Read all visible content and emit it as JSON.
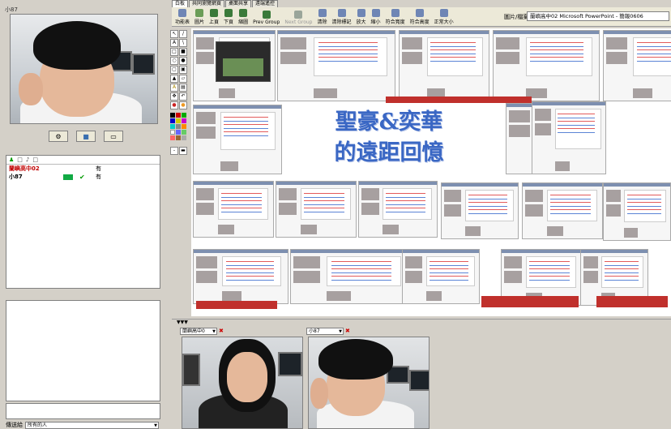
{
  "left_panel": {
    "cam_user": "小87",
    "cam_buttons": [
      "settings-icon",
      "video-icon",
      "monitor-icon"
    ],
    "user_list": {
      "header_icons": [
        "user-icon",
        "check-icon",
        "mic-icon",
        "video-icon"
      ],
      "rows": [
        {
          "name": "蘭嶼高中02",
          "status_ok": "",
          "flag": "有",
          "color": "#c00000"
        },
        {
          "name": "小87",
          "status_ok": "✔",
          "flag": "有",
          "color": "#000000"
        }
      ]
    },
    "send_label": "傳送給",
    "recipient": "所有的人"
  },
  "tabs": [
    "白板",
    "共同瀏覽網頁",
    "桌面共享",
    "遠端遙控"
  ],
  "toolbar": {
    "buttons": [
      {
        "label": "功能表",
        "icon": "menu-icon",
        "color": "#6f86b5",
        "disabled": false
      },
      {
        "label": "圖片",
        "icon": "picture-icon",
        "color": "#6b9d57",
        "disabled": false
      },
      {
        "label": "上頁",
        "icon": "prev-page-icon",
        "color": "#3a7a3a",
        "disabled": false
      },
      {
        "label": "下頁",
        "icon": "next-page-icon",
        "color": "#3a7a3a",
        "disabled": false
      },
      {
        "label": "縮圖",
        "icon": "thumbnail-icon",
        "color": "#3a7a3a",
        "disabled": false
      },
      {
        "label": "Prev Group",
        "icon": "prev-group-icon",
        "color": "#3a7a3a",
        "disabled": false
      },
      {
        "label": "Next Group",
        "icon": "next-group-icon",
        "color": "#9aa59a",
        "disabled": true
      },
      {
        "label": "清除",
        "icon": "clear-icon",
        "color": "#6f86b5",
        "disabled": false
      },
      {
        "label": "清除標記",
        "icon": "clear-marks-icon",
        "color": "#6f86b5",
        "disabled": false
      },
      {
        "label": "放大",
        "icon": "zoom-in-icon",
        "color": "#6f86b5",
        "disabled": false
      },
      {
        "label": "縮小",
        "icon": "zoom-out-icon",
        "color": "#6f86b5",
        "disabled": false
      },
      {
        "label": "符合寬度",
        "icon": "fit-width-icon",
        "color": "#6f86b5",
        "disabled": false
      },
      {
        "label": "符合高度",
        "icon": "fit-height-icon",
        "color": "#6f86b5",
        "disabled": false
      },
      {
        "label": "正常大小",
        "icon": "normal-size-icon",
        "color": "#6f86b5",
        "disabled": false
      }
    ],
    "doc_label": "圖片/檔案",
    "doc_value": "蘭嶼高中02 Microsoft PowerPoint - 簡報0606"
  },
  "slide": {
    "title_line1": "聖豪&奕華",
    "title_line2": "的遠距回憶",
    "title_color": "#3a67c4"
  },
  "video_panes": [
    {
      "user": "蘭嶼高中0"
    },
    {
      "user": "小87"
    }
  ]
}
